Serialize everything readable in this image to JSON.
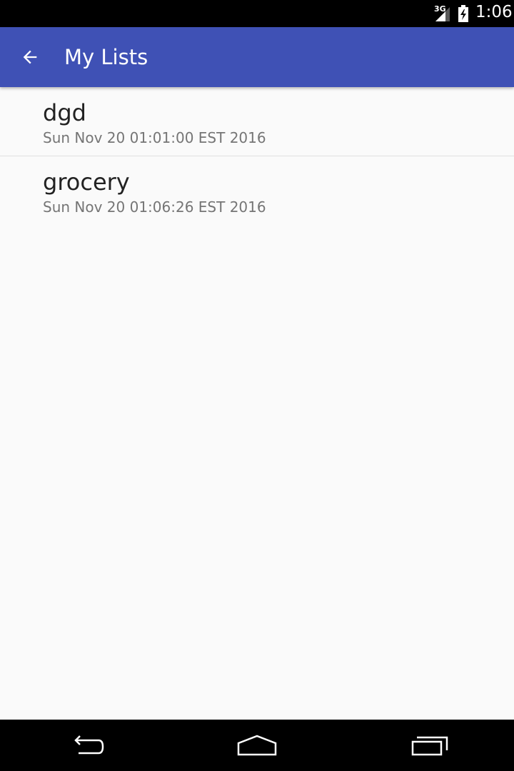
{
  "status_bar": {
    "network": "3G",
    "time": "1:06",
    "icons": [
      "signal-icon",
      "battery-charging-icon"
    ]
  },
  "app_bar": {
    "title": "My Lists",
    "background": "#3f51b5",
    "back_icon": "back-arrow-icon"
  },
  "lists": [
    {
      "name": "dgd",
      "date": "Sun Nov 20 01:01:00 EST 2016"
    },
    {
      "name": "grocery",
      "date": "Sun Nov 20 01:06:26 EST 2016"
    }
  ],
  "nav_bar": {
    "icons": [
      "back-icon",
      "home-icon",
      "recents-icon"
    ]
  }
}
